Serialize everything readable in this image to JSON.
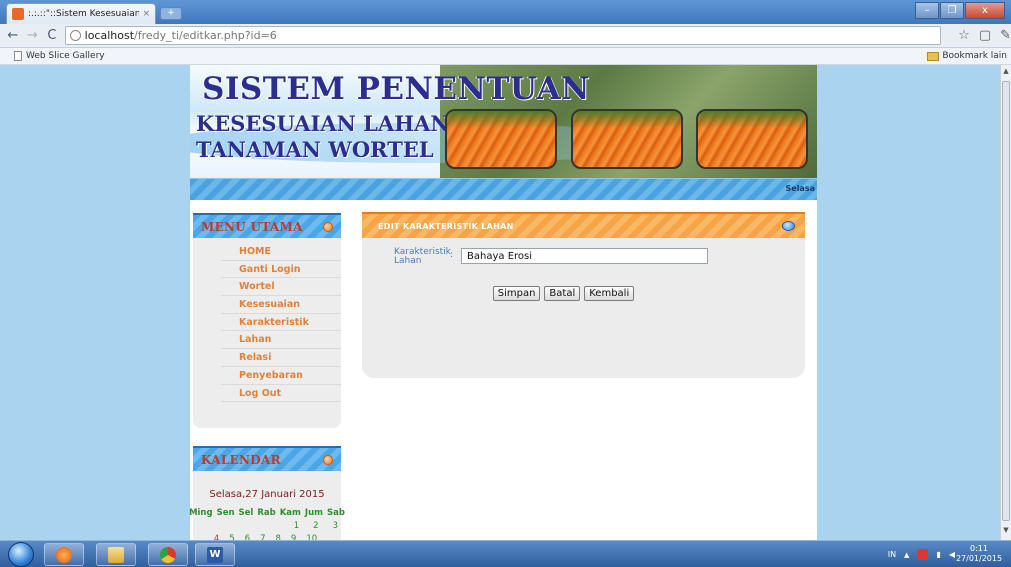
{
  "browser": {
    "tab_title": ":.:.::\"::Sistem Kesesuaian ...",
    "tab_close": "×",
    "new_tab": "+",
    "url_host": "localhost",
    "url_path": "/fredy_ti/editkar.php?id=6",
    "bookmark_left": "Web Slice Gallery",
    "bookmark_right": "Bookmark lain",
    "window_controls": [
      "–",
      "❐",
      "x"
    ]
  },
  "header": {
    "title_main": "SISTEM PENENTUAN",
    "title_line2": "KESESUAIAN LAHAN",
    "title_line3": "TANAMAN WORTEL",
    "marquee": "Selasa"
  },
  "menu": {
    "title": "MENU UTAMA",
    "items": [
      "HOME",
      "Ganti Login",
      "Wortel",
      "Kesesuaian",
      "Karakteristik",
      "Lahan",
      "Relasi",
      "Penyebaran",
      "Log Out"
    ]
  },
  "calendar": {
    "title": "KALENDAR",
    "date_text": "Selasa,27 Januari 2015",
    "weekdays": [
      "Ming",
      "Sen",
      "Sel",
      "Rab",
      "Kam",
      "Jum",
      "Sab"
    ],
    "row1": [
      "1",
      "2",
      "3"
    ],
    "row2": [
      "4",
      "5",
      "6",
      "7",
      "8",
      "9",
      "10"
    ]
  },
  "panel": {
    "title": "EDIT KARAKTERISTIK LAHAN",
    "field_label": "Karakteristik Lahan",
    "colon": ":",
    "field_value": "Bahaya Erosi",
    "save_label": "Simpan",
    "cancel_label": "Batal",
    "back_label": "Kembali"
  },
  "taskbar": {
    "lang": "IN",
    "time": "0:11",
    "date": "27/01/2015"
  },
  "colors": {
    "page_bg": "#a9d3ee",
    "title_blue": "#2b2e8f",
    "menu_orange": "#e2823a",
    "panel_header_orange": "#f6a445",
    "sidebar_header_blue": "#4aa6e4"
  }
}
